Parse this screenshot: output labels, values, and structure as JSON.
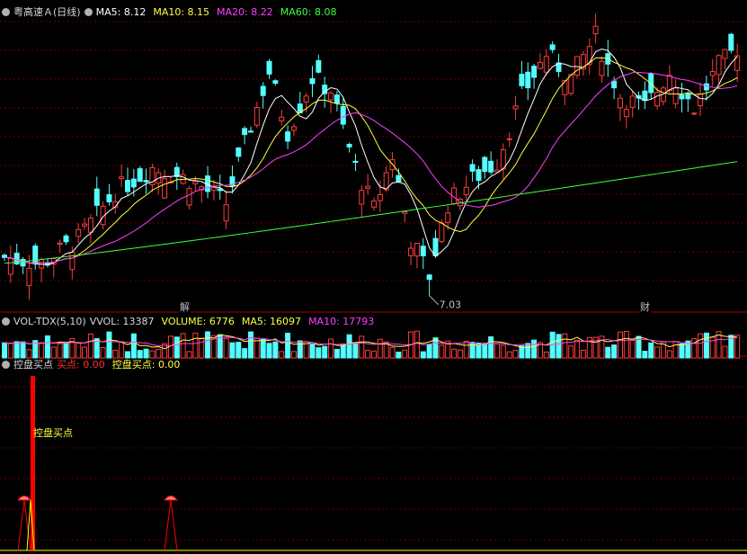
{
  "header": {
    "stock_title": "粤高速Ａ(日线)",
    "ma5_label": "MA5:",
    "ma5_value": "8.12",
    "ma10_label": "MA10:",
    "ma10_value": "8.15",
    "ma20_label": "MA20:",
    "ma20_value": "8.22",
    "ma60_label": "MA60:",
    "ma60_value": "8.08"
  },
  "volume_header": {
    "name": "VOL-TDX(5,10)",
    "vvol_label": "VVOL:",
    "vvol_value": "13387",
    "volume_label": "VOLUME:",
    "volume_value": "6776",
    "ma5_label": "MA5:",
    "ma5_value": "16097",
    "ma10_label": "MA10:",
    "ma10_value": "17793"
  },
  "indicator_header": {
    "name": "控盘买点",
    "buy_label": "买点:",
    "buy_value": "0.00",
    "ctrl_label": "控盘买点:",
    "ctrl_value": "0.00"
  },
  "annotations": {
    "low_label": "7.03",
    "event_1": "解",
    "event_2": "财",
    "signal_label": "控盘买点"
  },
  "colors": {
    "up": "#ff3c3c",
    "down": "#54ffff",
    "ma5": "#ffffff",
    "ma10": "#ffff40",
    "ma20": "#ff40ff",
    "ma60": "#40ff40",
    "signal": "#ff0000",
    "signal_line": "#ffff00"
  },
  "chart_data": [
    {
      "type": "candlestick",
      "title": "粤高速Ａ(日线)",
      "series": [
        {
          "name": "MA5",
          "last": 8.12
        },
        {
          "name": "MA10",
          "last": 8.15
        },
        {
          "name": "MA20",
          "last": 8.22
        },
        {
          "name": "MA60",
          "last": 8.08
        }
      ],
      "annotated_low": 7.03,
      "candle_count": 120
    },
    {
      "type": "bar",
      "title": "VOL-TDX(5,10)",
      "series": [
        {
          "name": "VVOL",
          "last": 13387
        },
        {
          "name": "VOLUME",
          "last": 6776
        },
        {
          "name": "MA5",
          "last": 16097
        },
        {
          "name": "MA10",
          "last": 17793
        }
      ]
    },
    {
      "type": "line",
      "title": "控盘买点",
      "series": [
        {
          "name": "买点",
          "last": 0.0
        },
        {
          "name": "控盘买点",
          "last": 0.0
        }
      ]
    }
  ]
}
